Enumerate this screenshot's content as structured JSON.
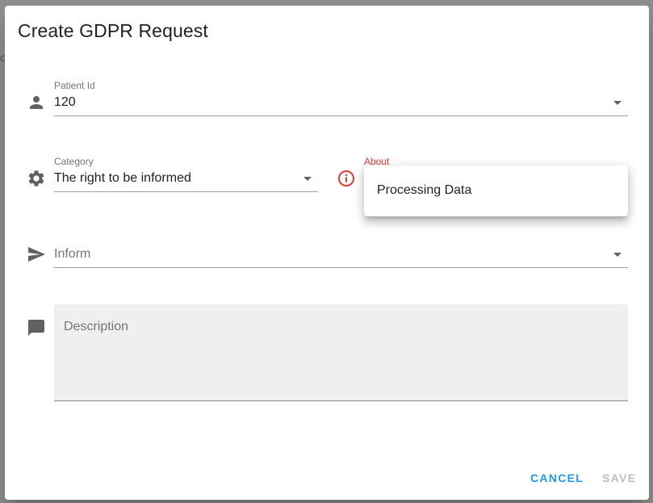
{
  "dialog": {
    "title": "Create GDPR Request"
  },
  "backdrop": {
    "partial_text": "o"
  },
  "patient_id": {
    "label": "Patient Id",
    "value": "120",
    "icon": "person-icon"
  },
  "category": {
    "label": "Category",
    "value": "The right to be informed",
    "icon": "gear-icon"
  },
  "about": {
    "label": "About",
    "error_icon": "error-info-icon",
    "error_color": "#e53935",
    "menu_items": [
      "Processing Data"
    ]
  },
  "inform": {
    "placeholder": "Inform",
    "icon": "send-icon"
  },
  "description": {
    "placeholder": "Description",
    "icon": "comment-icon"
  },
  "actions": {
    "cancel_label": "CANCEL",
    "save_label": "SAVE",
    "accent_color": "#2196f3",
    "disabled_color": "#bdbdbd"
  }
}
